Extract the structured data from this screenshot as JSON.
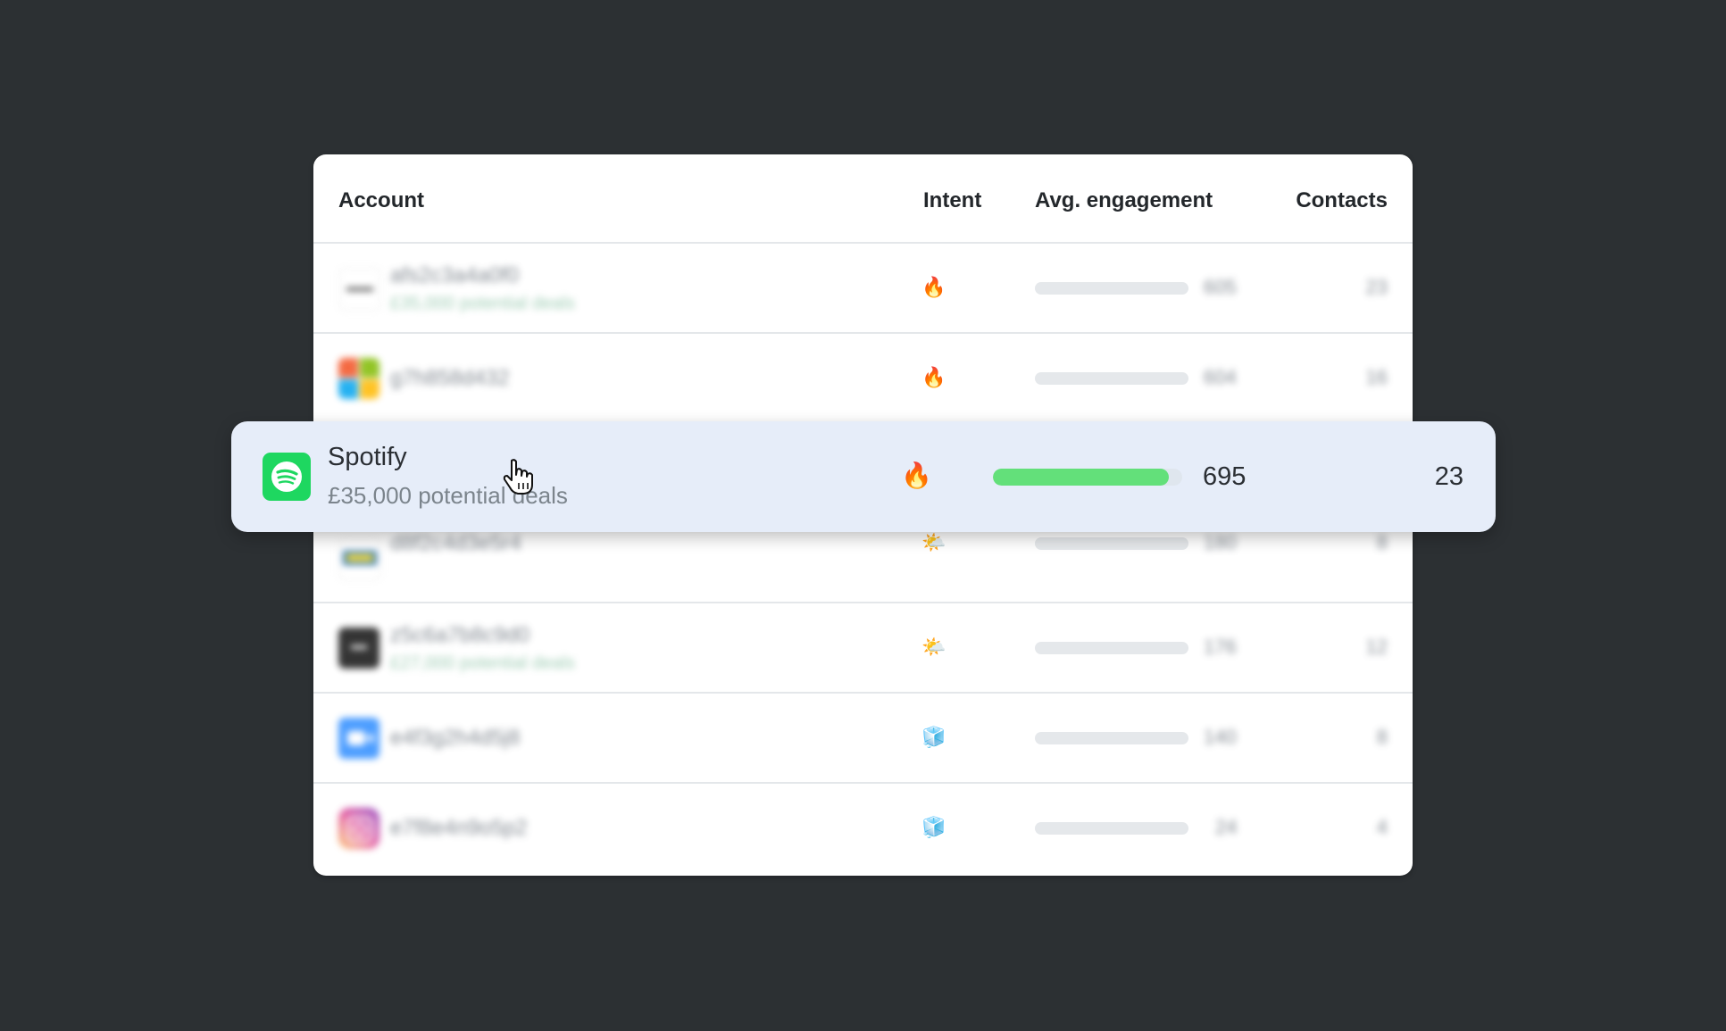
{
  "table": {
    "headers": {
      "account": "Account",
      "intent": "Intent",
      "engagement": "Avg. engagement",
      "contacts": "Contacts"
    },
    "rows": [
      {
        "name": "afs2c3a4a0f0",
        "subtitle": "£35,000 potential deals",
        "intent_icon": "🔥",
        "engagement": "605",
        "contacts": "23",
        "logo": "generic-icon"
      },
      {
        "name": "g7h858d432",
        "subtitle": "",
        "intent_icon": "🔥",
        "engagement": "604",
        "contacts": "16",
        "logo": "microsoft-icon"
      },
      {
        "name": "d8f2c4d3e5r4",
        "subtitle": "",
        "intent_icon": "🌤️",
        "engagement": "180",
        "contacts": "8",
        "logo": "ikea-icon"
      },
      {
        "name": "z5c6a7b8c9d0",
        "subtitle": "£27,000 potential deals",
        "intent_icon": "🌤️",
        "engagement": "176",
        "contacts": "12",
        "logo": "black-app-icon"
      },
      {
        "name": "e4f3g2h4d5j8",
        "subtitle": "",
        "intent_icon": "🧊",
        "engagement": "140",
        "contacts": "8",
        "logo": "zoom-icon"
      },
      {
        "name": "e7f8e4n9o5p2",
        "subtitle": "",
        "intent_icon": "🧊",
        "engagement": "24",
        "contacts": "4",
        "logo": "instagram-icon"
      }
    ]
  },
  "highlight": {
    "name": "Spotify",
    "subtitle": "£35,000 potential deals",
    "intent_icon": "🔥",
    "engagement": "695",
    "engagement_fraction": 0.93,
    "contacts": "23",
    "logo": "spotify-icon"
  },
  "colors": {
    "background": "#2c3033",
    "highlight_bg": "#e6edf9",
    "spotify_green": "#1ed760",
    "bar_fill": "#63e07a"
  }
}
